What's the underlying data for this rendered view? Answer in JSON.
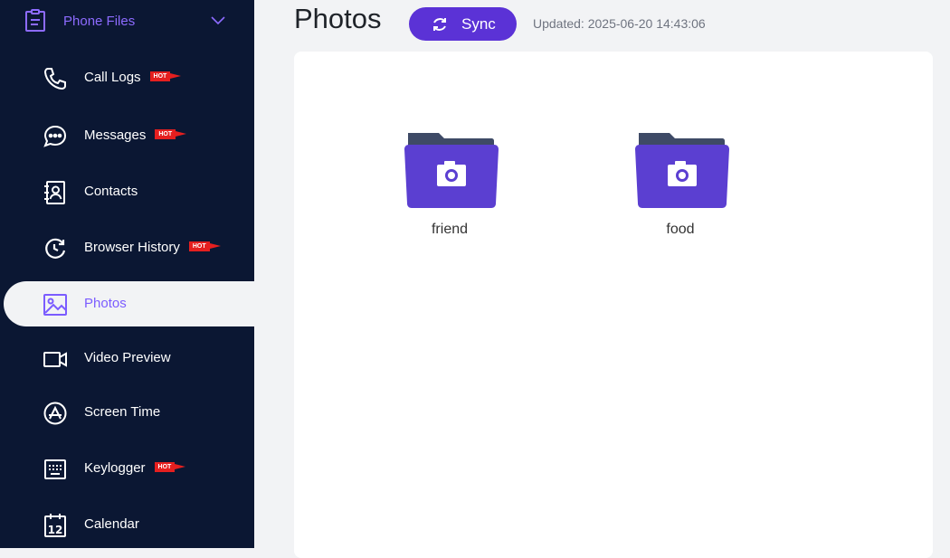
{
  "sidebar": {
    "header": {
      "label": "Phone Files"
    },
    "items": [
      {
        "label": "Call Logs",
        "hot": "HOT"
      },
      {
        "label": "Messages",
        "hot": "HOT"
      },
      {
        "label": "Contacts"
      },
      {
        "label": "Browser History",
        "hot": "HOT"
      },
      {
        "label": "Photos",
        "active": true
      },
      {
        "label": "Video Preview"
      },
      {
        "label": "Screen Time"
      },
      {
        "label": "Keylogger",
        "hot": "HOT"
      },
      {
        "label": "Calendar"
      }
    ]
  },
  "main": {
    "title": "Photos",
    "sync_label": "Sync",
    "updated": "Updated: 2025-06-20 14:43:06",
    "folders": [
      {
        "name": "friend"
      },
      {
        "name": "food"
      }
    ]
  },
  "colors": {
    "sidebar_bg": "#0b1733",
    "accent": "#5b32d6",
    "active_text": "#7b5cff",
    "hot_badge": "#e51f1f",
    "folder_body": "#5b3fd1",
    "folder_tab": "#3e4a66"
  },
  "icons": {
    "header": "clipboard-icon",
    "chevron": "chevron-down-icon",
    "items": [
      "phone-icon",
      "chat-icon",
      "contacts-icon",
      "history-icon",
      "image-icon",
      "video-icon",
      "app-store-icon",
      "keyboard-icon",
      "calendar-icon"
    ],
    "folder": "camera-folder-icon",
    "sync": "sync-icon"
  }
}
